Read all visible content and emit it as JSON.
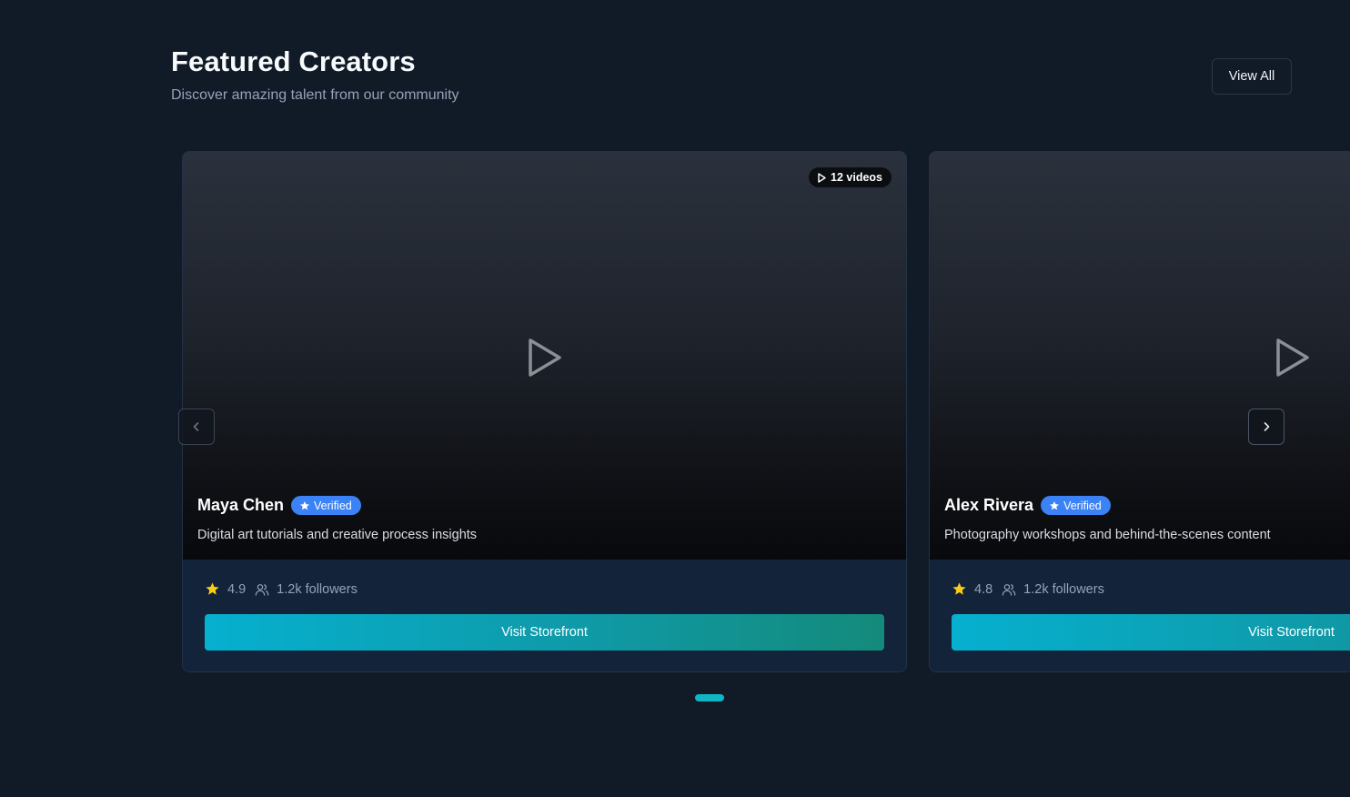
{
  "header": {
    "title": "Featured Creators",
    "subtitle": "Discover amazing talent from our community",
    "view_all_label": "View All"
  },
  "carousel": {
    "prev_icon": "chevron-left-icon",
    "next_icon": "chevron-right-icon",
    "active_page": 1,
    "page_count": 1
  },
  "cards": [
    {
      "video_count": "12 videos",
      "name": "Maya Chen",
      "verified_label": "Verified",
      "description": "Digital art tutorials and creative process insights",
      "rating": "4.9",
      "followers": "1.2k followers",
      "button_label": "Visit Storefront"
    },
    {
      "video_count": "",
      "name": "Alex Rivera",
      "verified_label": "Verified",
      "description": "Photography workshops and behind-the-scenes content",
      "rating": "4.8",
      "followers": "1.2k followers",
      "button_label": "Visit Storefront"
    }
  ],
  "colors": {
    "background": "#111a27",
    "card": "#13233a",
    "verified": "#3b82f6",
    "star": "#facc15",
    "button_start": "#06b0cf",
    "button_end": "#148a7a",
    "active_dot": "#0fb5c4"
  }
}
